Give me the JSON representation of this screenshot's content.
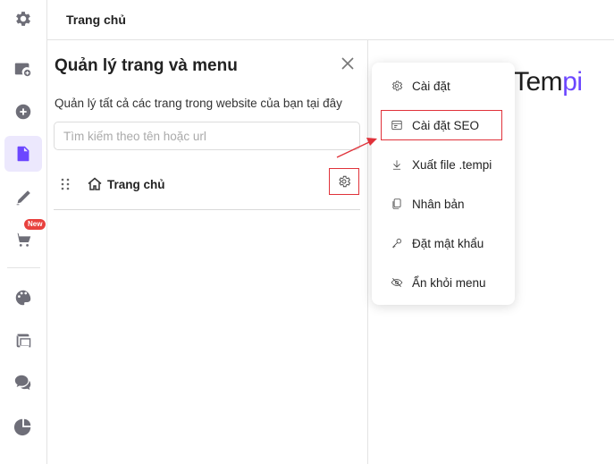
{
  "topbar": {
    "title": "Trang chủ"
  },
  "sidebar": {
    "badge": "New"
  },
  "panel": {
    "title": "Quản lý trang và menu",
    "description": "Quản lý tất cả các trang trong website của bạn tại đây",
    "search_placeholder": "Tìm kiếm theo tên hoặc url",
    "pages": [
      {
        "label": "Trang chủ"
      }
    ]
  },
  "brand": {
    "text": "Tem",
    "accent_text": "pi",
    "accent_color": "#6c47ff"
  },
  "menu": {
    "items": [
      {
        "label": "Cài đặt",
        "icon": "gear-icon"
      },
      {
        "label": "Cài đặt SEO",
        "icon": "seo-icon"
      },
      {
        "label": "Xuất file .tempi",
        "icon": "download-icon"
      },
      {
        "label": "Nhân bản",
        "icon": "duplicate-icon"
      },
      {
        "label": "Đặt mật khẩu",
        "icon": "key-icon"
      },
      {
        "label": "Ẩn khỏi menu",
        "icon": "eye-off-icon"
      }
    ]
  },
  "colors": {
    "accent": "#6c47ff",
    "highlight_red": "#e0323a",
    "active_bg": "#ece8fd"
  }
}
